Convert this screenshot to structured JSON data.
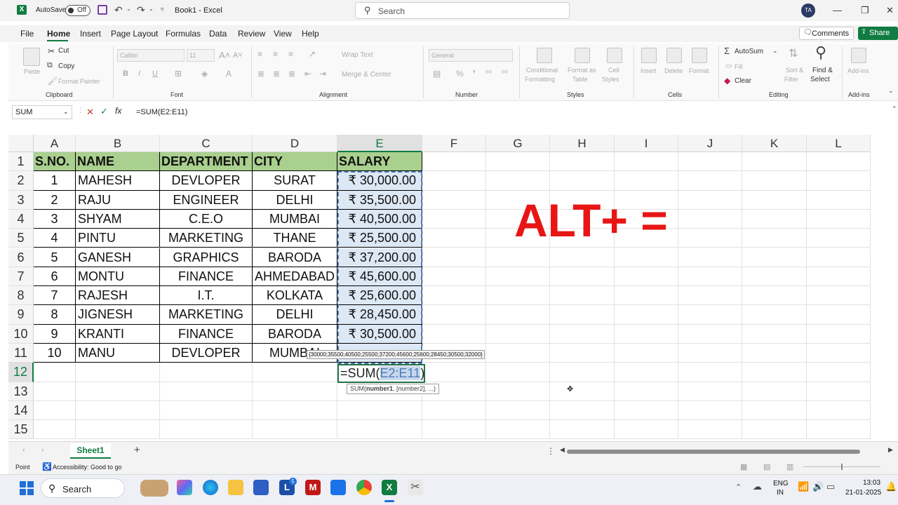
{
  "titlebar": {
    "autosave_label": "AutoSave",
    "autosave_state": "Off",
    "doc_title": "Book1 - Excel",
    "search_placeholder": "Search",
    "avatar_initials": "TA"
  },
  "menu": {
    "tabs": [
      "File",
      "Home",
      "Insert",
      "Page Layout",
      "Formulas",
      "Data",
      "Review",
      "View",
      "Help"
    ],
    "active_tab": "Home",
    "comments_label": "Comments",
    "share_label": "Share"
  },
  "ribbon": {
    "clipboard": {
      "paste": "Paste",
      "cut": "Cut",
      "copy": "Copy",
      "format_painter": "Format Painter",
      "group": "Clipboard"
    },
    "font": {
      "font_name": "Calibri",
      "font_size": "11",
      "group": "Font"
    },
    "alignment": {
      "wrap_text": "Wrap Text",
      "merge_center": "Merge & Center",
      "group": "Alignment"
    },
    "number": {
      "format": "General",
      "group": "Number"
    },
    "styles": {
      "conditional": "Conditional",
      "conditional2": "Formatting",
      "format_as": "Format as",
      "format_as2": "Table",
      "cell": "Cell",
      "cell2": "Styles",
      "group": "Styles"
    },
    "cells": {
      "insert": "Insert",
      "delete": "Delete",
      "format": "Format",
      "group": "Cells"
    },
    "editing": {
      "autosum": "AutoSum",
      "fill": "Fill",
      "clear": "Clear",
      "sort": "Sort &",
      "sort2": "Filter",
      "find": "Find &",
      "find2": "Select",
      "group": "Editing"
    },
    "addins": {
      "label": "Add-ins",
      "group": "Add-ins"
    }
  },
  "formula_bar": {
    "name_box": "SUM",
    "formula": "=SUM(E2:E11)"
  },
  "sheet": {
    "columns": [
      "A",
      "B",
      "C",
      "D",
      "E",
      "F",
      "G",
      "H",
      "I",
      "J",
      "K",
      "L"
    ],
    "row_numbers": [
      "1",
      "2",
      "3",
      "4",
      "5",
      "6",
      "7",
      "8",
      "9",
      "10",
      "11",
      "12",
      "13",
      "14",
      "15"
    ],
    "header": [
      "S.NO.",
      "NAME",
      "DEPARTMENT",
      "CITY",
      "SALARY"
    ],
    "rows": [
      [
        "1",
        "MAHESH",
        "DEVLOPER",
        "SURAT",
        "₹ 30,000.00"
      ],
      [
        "2",
        "RAJU",
        "ENGINEER",
        "DELHI",
        "₹ 35,500.00"
      ],
      [
        "3",
        "SHYAM",
        "C.E.O",
        "MUMBAI",
        "₹ 40,500.00"
      ],
      [
        "4",
        "PINTU",
        "MARKETING",
        "THANE",
        "₹ 25,500.00"
      ],
      [
        "5",
        "GANESH",
        "GRAPHICS",
        "BARODA",
        "₹ 37,200.00"
      ],
      [
        "6",
        "MONTU",
        "FINANCE",
        "AHMEDABAD",
        "₹ 45,600.00"
      ],
      [
        "7",
        "RAJESH",
        "I.T.",
        "KOLKATA",
        "₹ 25,600.00"
      ],
      [
        "8",
        "JIGNESH",
        "MARKETING",
        "DELHI",
        "₹ 28,450.00"
      ],
      [
        "9",
        "KRANTI",
        "FINANCE",
        "BARODA",
        "₹ 30,500.00"
      ],
      [
        "10",
        "MANU",
        "DEVLOPER",
        "MUMBAI",
        ""
      ]
    ],
    "array_tooltip": "{30000;35500;40500;25500;37200;45600;25600;28450;30500;32000}",
    "edit_prefix": "=SUM(",
    "edit_ref": "E2:E11",
    "edit_suffix": ")",
    "arg_tooltip_fn": "SUM(",
    "arg_tooltip_bold": "number1",
    "arg_tooltip_rest": ", [number2], ...)",
    "overlay_text": "ALT+ ="
  },
  "tabs_bar": {
    "sheet_name": "Sheet1",
    "add_sheet": "+"
  },
  "status": {
    "mode": "Point",
    "accessibility": "Accessibility: Good to go"
  },
  "taskbar": {
    "search": "Search",
    "lang1": "ENG",
    "lang2": "IN",
    "time": "13:03",
    "date": "21-01-2025",
    "badge": "5"
  },
  "colors": {
    "excel_green": "#107c41",
    "header_fill": "#a9d08e",
    "overlay_red": "#e81515",
    "ref_blue": "#4d7bb0"
  }
}
